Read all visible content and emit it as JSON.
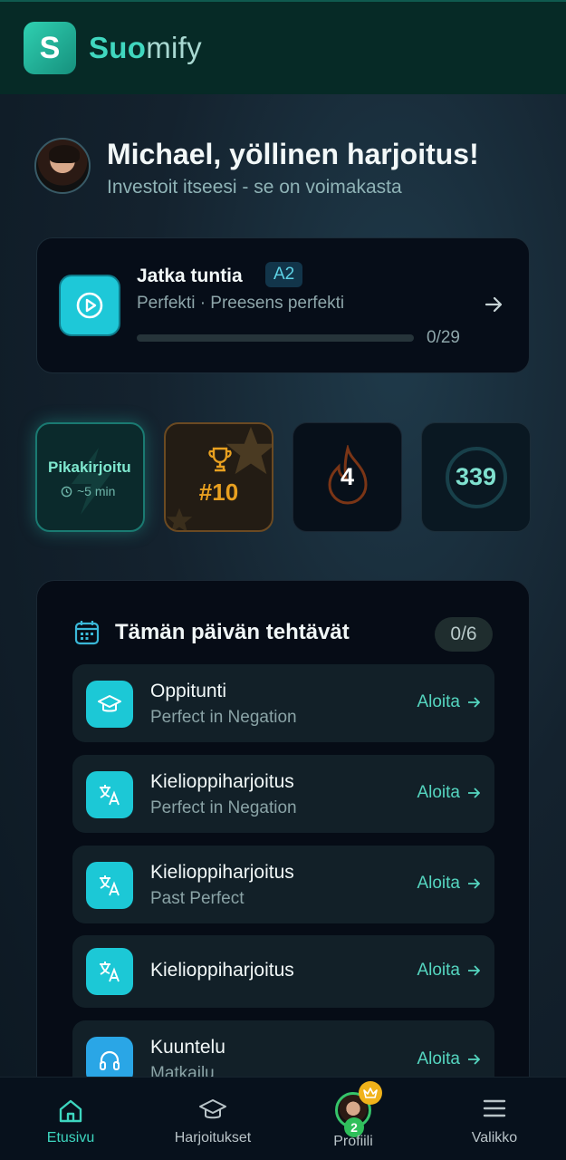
{
  "header": {
    "logo_letter": "S",
    "brand_part1": "Suo",
    "brand_part2": "mify"
  },
  "greeting": {
    "title": "Michael, yöllinen harjoitus!",
    "subtitle": "Investoit itseesi - se on voimakasta"
  },
  "continue_card": {
    "title": "Jatka tuntia",
    "level": "A2",
    "subtitle": "Perfekti · Preesens perfekti",
    "progress_text": "0/29",
    "progress_fraction": 0
  },
  "tiles": {
    "quick": {
      "label": "Pikakirjoitu",
      "time": "~5 min"
    },
    "rank": {
      "label": "#10"
    },
    "streak": {
      "value": "4"
    },
    "xp": {
      "value": "339"
    }
  },
  "tasks": {
    "title": "Tämän päivän tehtävät",
    "count": "0/6",
    "items": [
      {
        "title": "Oppitunti",
        "subtitle": "Perfect in Negation",
        "action": "Aloita",
        "icon": "graduation-cap-icon"
      },
      {
        "title": "Kielioppiharjoitus",
        "subtitle": "Perfect in Negation",
        "action": "Aloita",
        "icon": "translate-icon"
      },
      {
        "title": "Kielioppiharjoitus",
        "subtitle": "Past Perfect",
        "action": "Aloita",
        "icon": "translate-icon"
      },
      {
        "title": "Kielioppiharjoitus",
        "subtitle": "",
        "action": "Aloita",
        "icon": "translate-icon"
      },
      {
        "title": "Kuuntelu",
        "subtitle": "Matkailu",
        "action": "Aloita",
        "icon": "headphones-icon"
      }
    ]
  },
  "nav": {
    "home": "Etusivu",
    "exercises": "Harjoitukset",
    "profile": "Profiili",
    "profile_badge": "2",
    "menu": "Valikko"
  },
  "colors": {
    "accent": "#3dd6bf",
    "task_icon": "#1cc8d6",
    "rank_gold": "#e8a020"
  }
}
